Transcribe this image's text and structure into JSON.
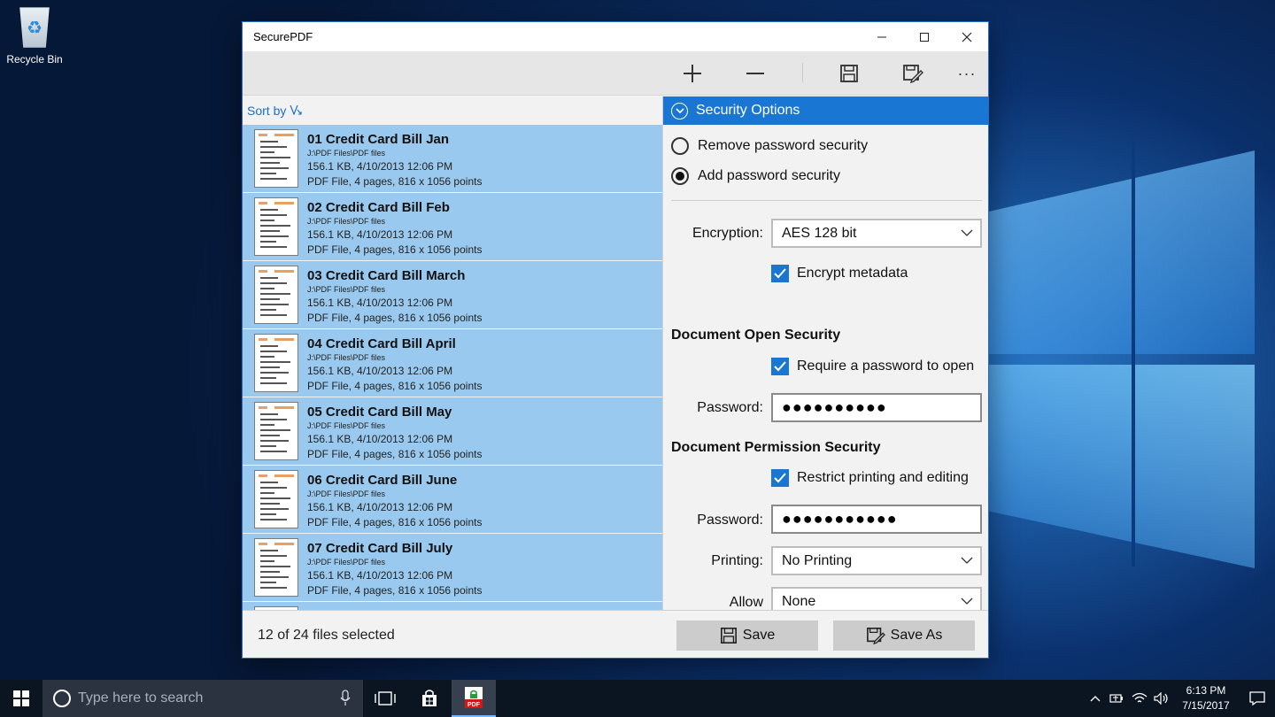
{
  "desktop": {
    "recycle_bin_label": "Recycle Bin"
  },
  "window": {
    "title": "SecurePDF",
    "controls": {
      "minimize": "—",
      "maximize": "☐",
      "close": "✕"
    }
  },
  "toolbar": {
    "icons": [
      "add-icon",
      "remove-icon",
      "save-icon",
      "save-as-icon",
      "more-icon"
    ],
    "more_label": "···"
  },
  "sort": {
    "label": "Sort by",
    "icon": "sort-icon"
  },
  "files": [
    {
      "name": "01 Credit Card Bill Jan",
      "path": "J:\\PDF Files\\PDF files",
      "size_date": "156.1 KB, 4/10/2013 12:06 PM",
      "details": "PDF File, 4 pages, 816 x 1056 points"
    },
    {
      "name": "02 Credit Card Bill Feb",
      "path": "J:\\PDF Files\\PDF files",
      "size_date": "156.1 KB, 4/10/2013 12:06 PM",
      "details": "PDF File, 4 pages, 816 x 1056 points"
    },
    {
      "name": "03 Credit Card Bill March",
      "path": "J:\\PDF Files\\PDF files",
      "size_date": "156.1 KB, 4/10/2013 12:06 PM",
      "details": "PDF File, 4 pages, 816 x 1056 points"
    },
    {
      "name": "04 Credit Card Bill April",
      "path": "J:\\PDF Files\\PDF files",
      "size_date": "156.1 KB, 4/10/2013 12:06 PM",
      "details": "PDF File, 4 pages, 816 x 1056 points"
    },
    {
      "name": "05 Credit Card Bill May",
      "path": "J:\\PDF Files\\PDF files",
      "size_date": "156.1 KB, 4/10/2013 12:06 PM",
      "details": "PDF File, 4 pages, 816 x 1056 points"
    },
    {
      "name": "06 Credit Card Bill June",
      "path": "J:\\PDF Files\\PDF files",
      "size_date": "156.1 KB, 4/10/2013 12:06 PM",
      "details": "PDF File, 4 pages, 816 x 1056 points"
    },
    {
      "name": "07 Credit Card Bill July",
      "path": "J:\\PDF Files\\PDF files",
      "size_date": "156.1 KB, 4/10/2013 12:06 PM",
      "details": "PDF File, 4 pages, 816 x 1056 points"
    }
  ],
  "security": {
    "header": "Security Options",
    "remove_option": "Remove password security",
    "add_option": "Add password security",
    "selected_option": "add",
    "encryption_label": "Encryption:",
    "encryption_value": "AES 128 bit",
    "encrypt_metadata_label": "Encrypt metadata",
    "encrypt_metadata_checked": true,
    "open_section_title": "Document Open Security",
    "require_password_label": "Require a password to open",
    "require_password_checked": true,
    "open_password_label": "Password:",
    "open_password_value": "●●●●●●●●●●",
    "permission_section_title": "Document Permission Security",
    "restrict_label": "Restrict printing and editing",
    "restrict_checked": true,
    "permission_password_label": "Password:",
    "permission_password_value": "●●●●●●●●●●●",
    "printing_label": "Printing:",
    "printing_value": "No Printing",
    "changes_label": "Allow changes:",
    "changes_value": "None"
  },
  "bottom": {
    "status": "12 of 24 files selected",
    "save_label": "Save",
    "save_as_label": "Save As"
  },
  "taskbar": {
    "search_placeholder": "Type here to search",
    "time": "6:13 PM",
    "date": "7/15/2017"
  },
  "colors": {
    "accent": "#1976d2",
    "selection": "#99c9ee"
  }
}
